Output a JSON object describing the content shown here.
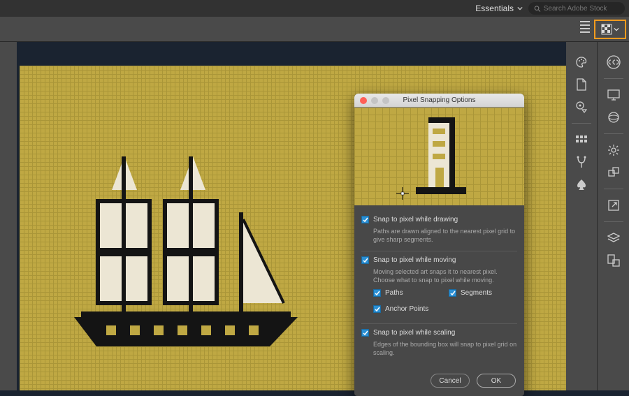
{
  "topbar": {
    "workspace": "Essentials",
    "search_placeholder": "Search Adobe Stock"
  },
  "dialog": {
    "title": "Pixel Snapping Options",
    "sections": [
      {
        "label": "Snap to pixel while drawing",
        "desc": "Paths are drawn aligned to the nearest pixel grid to give sharp segments.",
        "checked": true,
        "sub": []
      },
      {
        "label": "Snap to pixel while moving",
        "desc": "Moving selected art snaps it to nearest pixel. Choose what to snap to pixel while moving.",
        "checked": true,
        "sub": [
          {
            "label": "Paths",
            "checked": true
          },
          {
            "label": "Segments",
            "checked": true
          },
          {
            "label": "Anchor Points",
            "checked": true
          }
        ]
      },
      {
        "label": "Snap to pixel while scaling",
        "desc": "Edges of the bounding box will snap to pixel grid on scaling.",
        "checked": true,
        "sub": []
      }
    ],
    "buttons": {
      "cancel": "Cancel",
      "ok": "OK"
    }
  },
  "panels": {
    "left_col": [
      "palette-icon",
      "page-icon",
      "shape-target-icon",
      "swatches-grid-icon",
      "fork-icon",
      "spade-icon"
    ],
    "right_col": [
      "cc-libraries-icon",
      "monitor-icon",
      "sphere-icon",
      "sun-icon",
      "transform-icon",
      "export-icon",
      "layers-icon",
      "artboards-icon"
    ]
  }
}
